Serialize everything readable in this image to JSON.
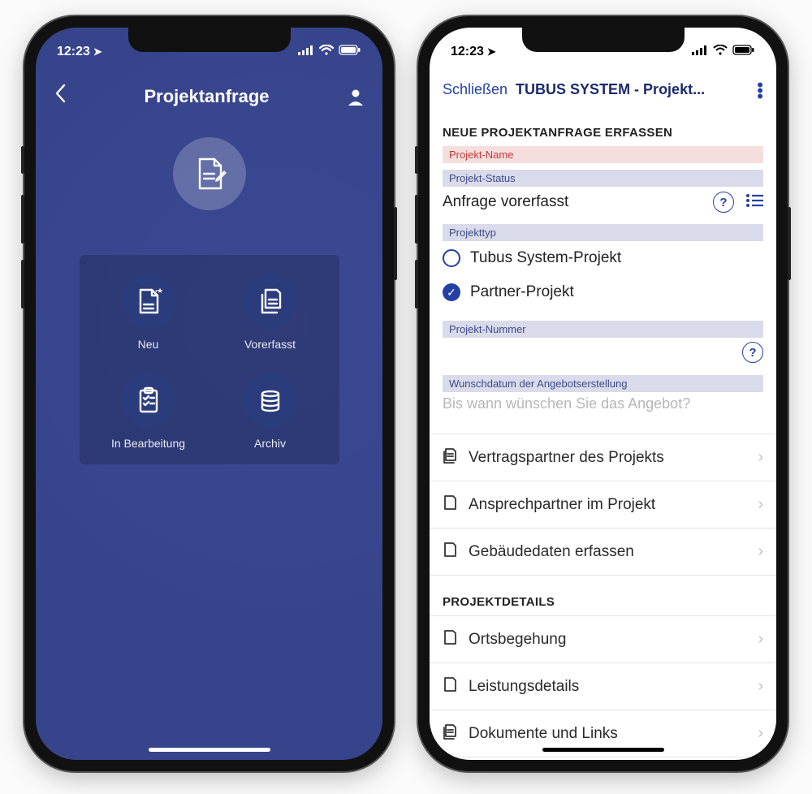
{
  "status": {
    "time": "12:23"
  },
  "left": {
    "header_title": "Projektanfrage",
    "tiles": [
      {
        "label": "Neu"
      },
      {
        "label": "Vorerfasst"
      },
      {
        "label": "In Bearbeitung"
      },
      {
        "label": "Archiv"
      }
    ]
  },
  "right": {
    "close_label": "Schließen",
    "header_title": "TUBUS SYSTEM - Projekt...",
    "section_new": "NEUE PROJEKTANFRAGE ERFASSEN",
    "field_project_name": "Projekt-Name",
    "field_project_status": "Projekt-Status",
    "status_value": "Anfrage vorerfasst",
    "field_project_type": "Projekttyp",
    "type_option_1": "Tubus System-Projekt",
    "type_option_2": "Partner-Projekt",
    "field_project_number": "Projekt-Nummer",
    "field_wish_date": "Wunschdatum der Angebotserstellung",
    "wish_placeholder": "Bis wann wünschen Sie das Angebot?",
    "links_a": [
      "Vertragspartner des Projekts",
      "Ansprechpartner im Projekt",
      "Gebäudedaten erfassen"
    ],
    "section_details": "PROJEKTDETAILS",
    "links_b": [
      "Ortsbegehung",
      "Leistungsdetails",
      "Dokumente und Links"
    ]
  }
}
